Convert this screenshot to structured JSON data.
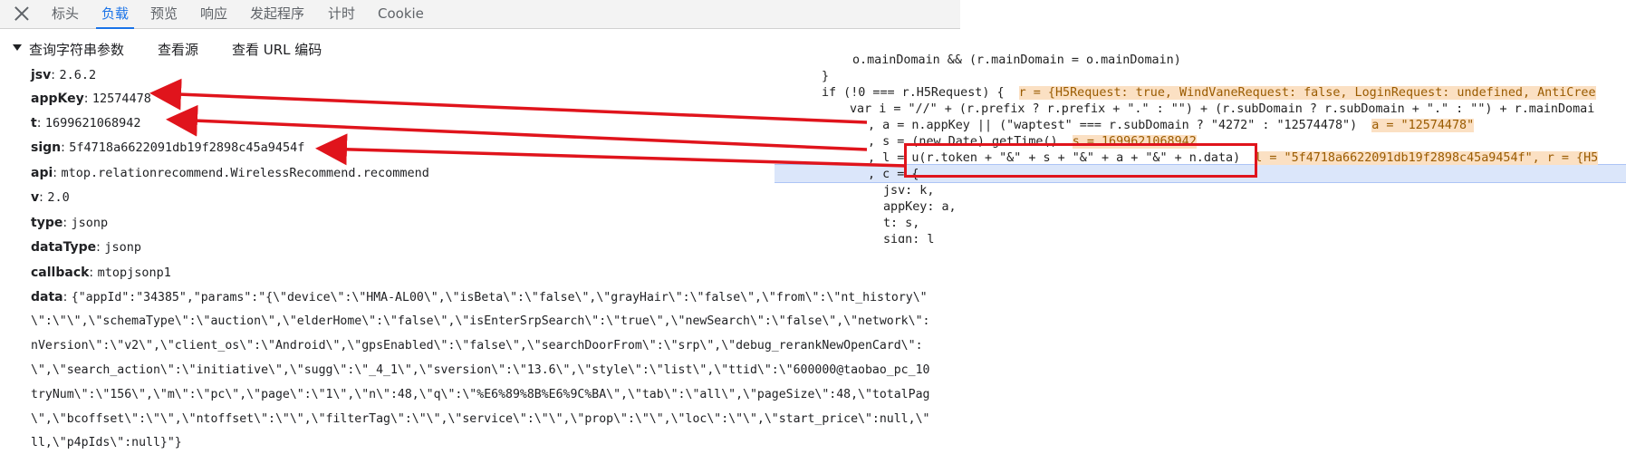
{
  "tabs": {
    "close_label": "×",
    "items": [
      "标头",
      "负载",
      "预览",
      "响应",
      "发起程序",
      "计时",
      "Cookie"
    ],
    "active": "负载"
  },
  "payload": {
    "section_title": "查询字符串参数",
    "view_source": "查看源",
    "view_url_encoded": "查看 URL 编码",
    "params": [
      {
        "key": "jsv",
        "value": "2.6.2"
      },
      {
        "key": "appKey",
        "value": "12574478"
      },
      {
        "key": "t",
        "value": "1699621068942"
      },
      {
        "key": "sign",
        "value": "5f4718a6622091db19f2898c45a9454f"
      },
      {
        "key": "api",
        "value": "mtop.relationrecommend.WirelessRecommend.recommend"
      },
      {
        "key": "v",
        "value": "2.0"
      },
      {
        "key": "type",
        "value": "jsonp"
      },
      {
        "key": "dataType",
        "value": "jsonp"
      },
      {
        "key": "callback",
        "value": "mtopjsonp1"
      }
    ],
    "data_key": "data",
    "data_lines": [
      "{\"appId\":\"34385\",\"params\":\"{\\\"device\\\":\\\"HMA-AL00\\\",\\\"isBeta\\\":\\\"false\\\",\\\"grayHair\\\":\\\"false\\\",\\\"from\\\":\\\"nt_history\\\"",
      "\\\":\\\"\\\",\\\"schemaType\\\":\\\"auction\\\",\\\"elderHome\\\":\\\"false\\\",\\\"isEnterSrpSearch\\\":\\\"true\\\",\\\"newSearch\\\":\\\"false\\\",\\\"network\\\":",
      "nVersion\\\":\\\"v2\\\",\\\"client_os\\\":\\\"Android\\\",\\\"gpsEnabled\\\":\\\"false\\\",\\\"searchDoorFrom\\\":\\\"srp\\\",\\\"debug_rerankNewOpenCard\\\":",
      "\\\",\\\"search_action\\\":\\\"initiative\\\",\\\"sugg\\\":\\\"_4_1\\\",\\\"sversion\\\":\\\"13.6\\\",\\\"style\\\":\\\"list\\\",\\\"ttid\\\":\\\"600000@taobao_pc_10",
      "tryNum\\\":\\\"156\\\",\\\"m\\\":\\\"pc\\\",\\\"page\\\":\\\"1\\\",\\\"n\\\":48,\\\"q\\\":\\\"%E6%89%8B%E6%9C%BA\\\",\\\"tab\\\":\\\"all\\\",\\\"pageSize\\\":48,\\\"totalPag",
      "\\\",\\\"bcoffset\\\":\\\"\\\",\\\"ntoffset\\\":\\\"\\\",\\\"filterTag\\\":\\\"\\\",\\\"service\\\":\\\"\\\",\\\"prop\\\":\\\"\\\",\\\"loc\\\":\\\"\\\",\\\"start_price\\\":null,\\\"",
      "ll,\\\"p4pIds\\\":null}\"}"
    ]
  },
  "code": {
    "line1": "o.mainDomain && (r.mainDomain = o.mainDomain)",
    "line2": "}",
    "line3_code": "if (!0 === r.H5Request) {",
    "line3_inline": "r = {H5Request: true, WindVaneRequest: false, LoginRequest: undefined, AntiCree",
    "line4_code": "var i = \"//\" + (r.prefix ? r.prefix + \".\" : \"\") + (r.subDomain ? r.subDomain + \".\" : \"\") + r.mainDomai",
    "line5_code": ", a = n.appKey || (\"waptest\" === r.subDomain ? \"4272\" : \"12574478\")",
    "line5_inline": "a = \"12574478\"",
    "line6_code": ", s = (new Date).getTime()",
    "line6_inline": "s = 1699621068942",
    "line7_code": ", l = u(r.token + \"&\" + s + \"&\" + a + \"&\" + n.data)",
    "line7_inline": "l = \"5f4718a6622091db19f2898c45a9454f\", r = {H5",
    "line8_code": ", c = {",
    "line9": "jsv: k,",
    "line10": "appKey: a,",
    "line11": "t: s,",
    "line12": "sign: l"
  },
  "colors": {
    "accent": "#1a73e8",
    "arrow": "#e0141c",
    "highlight_line": "#dbe6fa",
    "inline_value_bg": "#fbe0c3"
  }
}
